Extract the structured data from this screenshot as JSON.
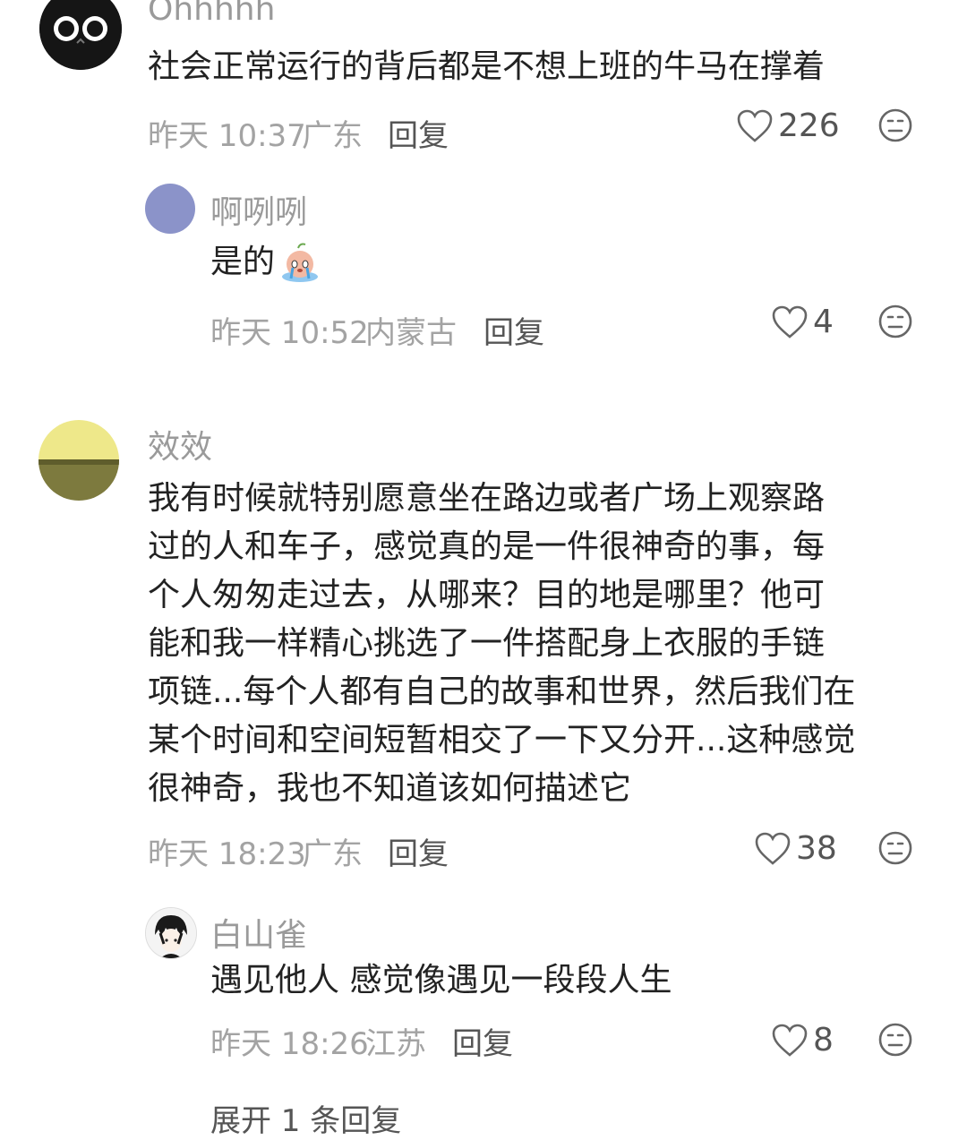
{
  "comments": [
    {
      "username": "Ohhhhh",
      "text_lines": [
        "社会正常运行的背后都是不想上班的牛马在撑着"
      ],
      "time": "昨天 10:37",
      "location": "广东",
      "reply_label": "回复",
      "likes": "226",
      "replies": [
        {
          "username": "啊咧咧",
          "text": "是的",
          "time": "昨天 10:52",
          "location": "内蒙古",
          "reply_label": "回复",
          "likes": "4"
        }
      ]
    },
    {
      "username": "效效",
      "text_lines": [
        "我有时候就特别愿意坐在路边或者广场上观察路",
        "过的人和车子，感觉真的是一件很神奇的事，每",
        "个人匆匆走过去，从哪来？目的地是哪里？他可",
        "能和我一样精心挑选了一件搭配身上衣服的手链",
        "项链...每个人都有自己的故事和世界，然后我们在",
        "某个时间和空间短暂相交了一下又分开...这种感觉",
        "很神奇，我也不知道该如何描述它"
      ],
      "time": "昨天 18:23",
      "location": "广东",
      "reply_label": "回复",
      "likes": "38",
      "replies": [
        {
          "username": "白山雀",
          "text": "遇见他人 感觉像遇见一段段人生",
          "time": "昨天 18:26",
          "location": "江苏",
          "reply_label": "回复",
          "likes": "8"
        }
      ],
      "expand_label": "展开 1 条回复"
    }
  ]
}
